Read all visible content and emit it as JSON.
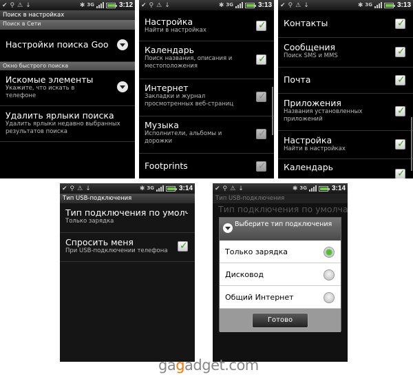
{
  "status_times": [
    "3:12",
    "3:13",
    "3:13",
    "3:14",
    "3:14"
  ],
  "status": {
    "net": "3G"
  },
  "screen1": {
    "title": "Поиск в настройках",
    "section1": "Поиск в Сети",
    "web_search_item": "Настройки поиска Googl",
    "section2": "Окно быстрого поиска",
    "searchable": {
      "title": "Искомые элементы",
      "sub": "Укажите, что искать в телефоне"
    },
    "clear": {
      "title": "Удалить ярлыки поиска",
      "sub": "Удалить ярлыки недавно выбранных результатов поиска"
    }
  },
  "screen2": {
    "items": [
      {
        "title": "Настройка",
        "sub": "Найти в настройках",
        "checked": true
      },
      {
        "title": "Календарь",
        "sub": "Поиск названия, описания и местоположения",
        "checked": true
      },
      {
        "title": "Интернет",
        "sub": "Закладки и журнал просмотренных веб-страниц",
        "checked": false
      },
      {
        "title": "Музыка",
        "sub": "Исполнители, альбомы и дорожки",
        "checked": false
      },
      {
        "title": "Footprints",
        "sub": "",
        "checked": false
      }
    ]
  },
  "screen3": {
    "items": [
      {
        "title": "Контакты",
        "sub": "",
        "checked": true
      },
      {
        "title": "Сообщения",
        "sub": "Поиск SMS и MMS",
        "checked": true
      },
      {
        "title": "Почта",
        "sub": "",
        "checked": true
      },
      {
        "title": "Приложения",
        "sub": "Названия установленных приложений",
        "checked": true
      },
      {
        "title": "Настройка",
        "sub": "Найти в настройках",
        "checked": true
      },
      {
        "title": "Календарь",
        "sub": "",
        "checked": true
      }
    ]
  },
  "screen4": {
    "title": "Тип USB-подключения",
    "conn_type": {
      "title": "Тип подключения по умолча",
      "sub": "Только зарядка"
    },
    "ask_me": {
      "title": "Спросить меня",
      "sub": "При USB-подключении телефона",
      "checked": true
    }
  },
  "screen5": {
    "bg_title": "Тип USB-подключения",
    "bg_text": "Тип подключения по умолча",
    "dialog_title": "Выберите тип подключения",
    "options": [
      {
        "label": "Только зарядка",
        "selected": true
      },
      {
        "label": "Дисковод",
        "selected": false
      },
      {
        "label": "Общий Интернет",
        "selected": false
      }
    ],
    "done_label": "Готово"
  },
  "brand": {
    "pre": "ga",
    "mid": "g",
    "post": "adget.com"
  },
  "colors": {
    "check_green": "#3ea51c",
    "radio_green": "#4fc22a",
    "brand_orange": "#f27b00"
  }
}
